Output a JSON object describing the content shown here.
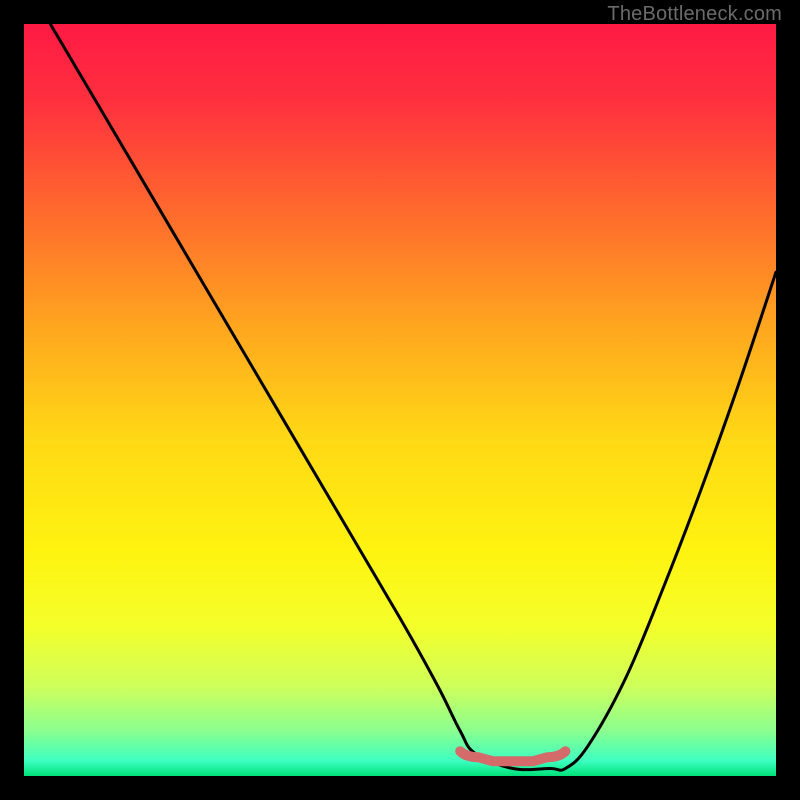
{
  "watermark": "TheBottleneck.com",
  "chart_data": {
    "type": "line",
    "title": "",
    "xlabel": "",
    "ylabel": "",
    "xlim": [
      0,
      100
    ],
    "ylim": [
      0,
      100
    ],
    "background_gradient": {
      "stops": [
        {
          "offset": 0.0,
          "color": "#ff1a44"
        },
        {
          "offset": 0.1,
          "color": "#ff2f3f"
        },
        {
          "offset": 0.25,
          "color": "#ff6a2d"
        },
        {
          "offset": 0.4,
          "color": "#ffa51f"
        },
        {
          "offset": 0.55,
          "color": "#ffd815"
        },
        {
          "offset": 0.7,
          "color": "#fff310"
        },
        {
          "offset": 0.8,
          "color": "#f4ff2a"
        },
        {
          "offset": 0.88,
          "color": "#cfff5a"
        },
        {
          "offset": 0.94,
          "color": "#8bff90"
        },
        {
          "offset": 0.98,
          "color": "#3dffc0"
        },
        {
          "offset": 1.0,
          "color": "#00e07a"
        }
      ]
    },
    "series": [
      {
        "name": "bottleneck-curve",
        "color": "#000000",
        "x": [
          3.5,
          10,
          20,
          30,
          40,
          50,
          55,
          58,
          60,
          65,
          70,
          72,
          75,
          80,
          85,
          90,
          95,
          100
        ],
        "values": [
          100,
          89,
          72,
          55,
          38,
          21,
          12,
          6,
          3,
          1,
          1,
          1,
          4,
          13,
          25,
          38,
          52,
          67
        ]
      }
    ],
    "highlight_segment": {
      "name": "optimal-range",
      "color": "#d46a6a",
      "x_start": 58,
      "x_end": 72,
      "y": 2.5
    }
  }
}
